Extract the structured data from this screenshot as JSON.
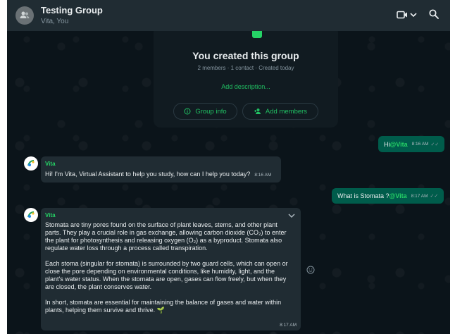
{
  "header": {
    "title": "Testing Group",
    "subtitle": "Vita, You"
  },
  "card": {
    "title": "You created this group",
    "meta": "2 members · 1 contact · Created today",
    "add_description": "Add description...",
    "group_info": "Group info",
    "add_members": "Add members"
  },
  "messages": {
    "m1": {
      "text": "Hi ",
      "mention": "@Vita",
      "time": "8:16 AM"
    },
    "m2": {
      "sender": "Vita",
      "text": "Hi! I'm Vita, Virtual Assistant to help you study, how can I help you today?",
      "time": "8:16 AM"
    },
    "m3": {
      "text": "What is Stomata ? ",
      "mention": "@Vita",
      "time": "8:17 AM"
    },
    "m4": {
      "sender": "Vita",
      "p1": "Stomata are tiny pores found on the surface of plant leaves, stems, and other plant parts. They play a crucial role in gas exchange, allowing carbon dioxide (CO₂) to enter the plant for photosynthesis and releasing oxygen (O₂) as a byproduct. Stomata also regulate water loss through a process called transpiration.",
      "p2": "Each stoma (singular for stomata) is surrounded by two guard cells, which can open or close the pore depending on environmental conditions, like humidity, light, and the plant's water status. When the stomata are open, gases can flow freely, but when they are closed, the plant conserves water.",
      "p3": "In short, stomata are essential for maintaining the balance of gases and water within plants, helping them survive and thrive. 🌱",
      "time": "8:17 AM"
    }
  },
  "colors": {
    "background": "#0b141a",
    "header": "#202c33",
    "outgoing": "#005c4b",
    "incoming": "#202c33",
    "accent": "#25d366"
  },
  "icons": [
    "group-avatar-icon",
    "video-call-icon",
    "chevron-down-icon",
    "search-icon",
    "info-icon",
    "add-members-icon",
    "double-check-icon",
    "bot-avatar-icon",
    "emoji-reaction-icon"
  ]
}
